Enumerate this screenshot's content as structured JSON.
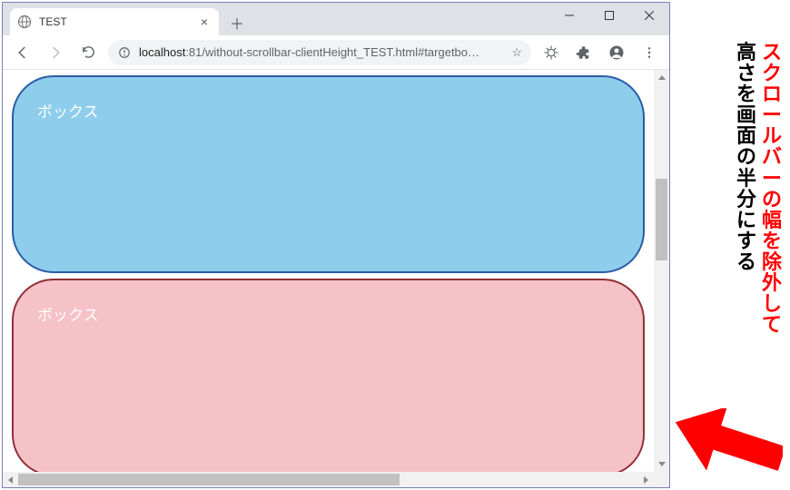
{
  "window": {
    "tab_title": "TEST",
    "new_tab_glyph": "＋",
    "close_glyph": "×",
    "minimize_label": "Minimize",
    "maximize_label": "Maximize",
    "closewin_label": "Close"
  },
  "toolbar": {
    "url_host": "localhost",
    "url_port": ":81",
    "url_path": "/without-scrollbar-clientHeight_TEST.html#targetbo…",
    "star_glyph": "☆"
  },
  "page": {
    "box1_label": "ボックス",
    "box2_label": "ボックス"
  },
  "annotation": {
    "line_red": "スクロールバーの幅を除外して",
    "line_black": "高さを画面の半分にする"
  },
  "colors": {
    "arrow": "#ff0000",
    "blue_box_fill": "#8ecdeb",
    "blue_box_border": "#2a5da5",
    "pink_box_fill": "#f5c2c8",
    "pink_box_border": "#923038"
  }
}
